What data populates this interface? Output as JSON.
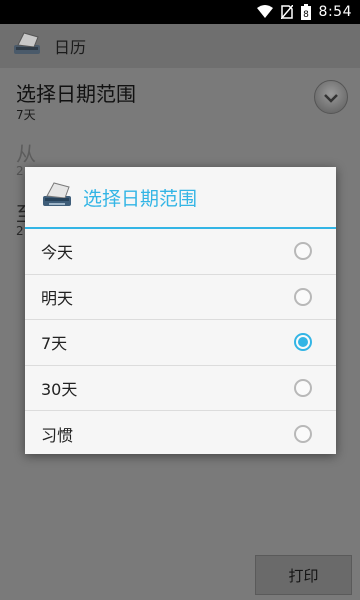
{
  "status_bar": {
    "time": "8:54",
    "battery_level": "8"
  },
  "app_bar": {
    "title": "日历",
    "icon": "printer-icon"
  },
  "background": {
    "heading": "选择日期范围",
    "selected_range": "7天",
    "from_label": "从",
    "from_value": "2",
    "to_label": "至",
    "to_value": "2",
    "print_button": "打印"
  },
  "dialog": {
    "title": "选择日期范围",
    "icon": "printer-icon",
    "accent_color": "#33b5e5",
    "options": [
      {
        "label": "今天",
        "checked": false
      },
      {
        "label": "明天",
        "checked": false
      },
      {
        "label": "7天",
        "checked": true
      },
      {
        "label": "30天",
        "checked": false
      },
      {
        "label": "习惯",
        "checked": false
      }
    ]
  }
}
